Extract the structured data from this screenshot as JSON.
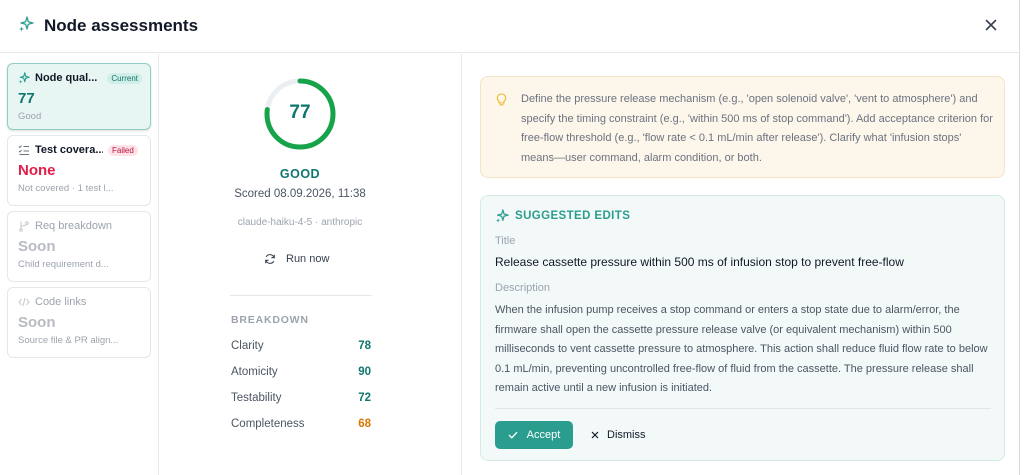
{
  "header": {
    "title": "Node assessments",
    "icon": "sparkle-icon"
  },
  "nav": {
    "items": [
      {
        "name": "Node qual...",
        "badge": "Current",
        "value": "77",
        "sub": "Good",
        "icon": "sparkle-icon"
      },
      {
        "name": "Test covera...",
        "badge": "Failed",
        "value": "None",
        "sub": "Not covered · 1 test l...",
        "icon": "checklist-icon"
      },
      {
        "name": "Req breakdown",
        "value": "Soon",
        "sub": "Child requirement d...",
        "icon": "branch-icon"
      },
      {
        "name": "Code links",
        "value": "Soon",
        "sub": "Source file & PR align...",
        "icon": "code-icon"
      }
    ]
  },
  "score": {
    "value": "77",
    "gauge_fraction": 0.77,
    "verdict": "GOOD",
    "scored": "Scored 08.09.2026, 11:38",
    "model": "claude-haiku-4-5 · anthropic",
    "run_label": "Run now"
  },
  "breakdown": {
    "title": "BREAKDOWN",
    "rows": [
      {
        "label": "Clarity",
        "value": "78"
      },
      {
        "label": "Atomicity",
        "value": "90"
      },
      {
        "label": "Testability",
        "value": "72"
      },
      {
        "label": "Completeness",
        "value": "68"
      }
    ]
  },
  "hint": {
    "text": "Define the pressure release mechanism (e.g., 'open solenoid valve', 'vent to atmosphere') and specify the timing constraint (e.g., 'within 500 ms of stop command'). Add acceptance criterion for free-flow threshold (e.g., 'flow rate < 0.1 mL/min after release'). Clarify what 'infusion stops' means—user command, alarm condition, or both."
  },
  "suggested": {
    "heading": "SUGGESTED EDITS",
    "title_label": "Title",
    "title_value": "Release cassette pressure within 500 ms of infusion stop to prevent free-flow",
    "description_label": "Description",
    "description_value": "When the infusion pump receives a stop command or enters a stop state due to alarm/error, the firmware shall open the cassette pressure release valve (or equivalent mechanism) within 500 milliseconds to vent cassette pressure to atmosphere. This action shall reduce fluid flow rate to below 0.1 mL/min, preventing uncontrolled free-flow of fluid from the cassette. The pressure release shall remain active until a new infusion is initiated.",
    "accept_label": "Accept",
    "dismiss_label": "Dismiss"
  },
  "colors": {
    "accent": "#0f766e",
    "accent_button": "#2a9d8f",
    "failed": "#e11d48",
    "warning": "#d97706",
    "hint_bg": "#fdf6ea"
  }
}
